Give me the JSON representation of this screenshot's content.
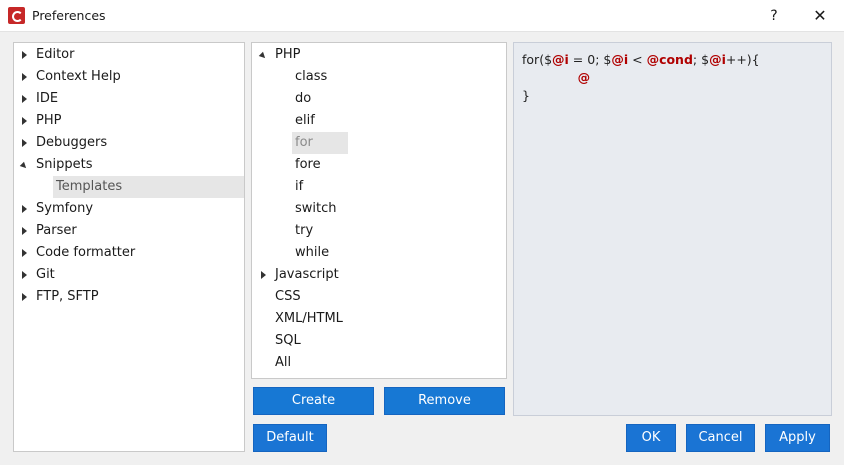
{
  "window": {
    "title": "Preferences",
    "help_label": "?",
    "close_label": "✕"
  },
  "left_tree": {
    "items": [
      {
        "label": "Editor",
        "expander": "collapsed"
      },
      {
        "label": "Context Help",
        "expander": "collapsed"
      },
      {
        "label": "IDE",
        "expander": "collapsed"
      },
      {
        "label": "PHP",
        "expander": "collapsed"
      },
      {
        "label": "Debuggers",
        "expander": "collapsed"
      },
      {
        "label": "Snippets",
        "expander": "expanded"
      },
      {
        "label": "Templates",
        "expander": "none",
        "selected": true
      },
      {
        "label": "Symfony",
        "expander": "collapsed"
      },
      {
        "label": "Parser",
        "expander": "collapsed"
      },
      {
        "label": "Code formatter",
        "expander": "collapsed"
      },
      {
        "label": "Git",
        "expander": "collapsed"
      },
      {
        "label": "FTP, SFTP",
        "expander": "collapsed"
      }
    ]
  },
  "middle_tree": {
    "items": [
      {
        "label": "PHP",
        "expander": "expanded"
      },
      {
        "label": "class",
        "expander": "none"
      },
      {
        "label": "do",
        "expander": "none"
      },
      {
        "label": "elif",
        "expander": "none"
      },
      {
        "label": "for",
        "expander": "none",
        "selected": true
      },
      {
        "label": "fore",
        "expander": "none"
      },
      {
        "label": "if",
        "expander": "none"
      },
      {
        "label": "switch",
        "expander": "none"
      },
      {
        "label": "try",
        "expander": "none"
      },
      {
        "label": "while",
        "expander": "none"
      },
      {
        "label": "Javascript",
        "expander": "collapsed"
      },
      {
        "label": "CSS",
        "expander": "none"
      },
      {
        "label": "XML/HTML",
        "expander": "none"
      },
      {
        "label": "SQL",
        "expander": "none"
      },
      {
        "label": "All",
        "expander": "none"
      }
    ]
  },
  "code": {
    "line1": [
      {
        "t": "for($",
        "v": false
      },
      {
        "t": "@i",
        "v": true
      },
      {
        "t": " = 0; $",
        "v": false
      },
      {
        "t": "@i",
        "v": true
      },
      {
        "t": " < ",
        "v": false
      },
      {
        "t": "@cond",
        "v": true
      },
      {
        "t": "; $",
        "v": false
      },
      {
        "t": "@i",
        "v": true
      },
      {
        "t": "++){",
        "v": false
      }
    ],
    "line2": [
      {
        "t": "              ",
        "v": false
      },
      {
        "t": "@",
        "v": true
      }
    ],
    "line3": [
      {
        "t": "}",
        "v": false
      }
    ]
  },
  "buttons": {
    "create": "Create",
    "remove": "Remove",
    "default": "Default",
    "ok": "OK",
    "cancel": "Cancel",
    "apply": "Apply"
  },
  "colors": {
    "accent": "#1a74d4",
    "snippet_variable": "#b00000",
    "selection": "#e6e6e6"
  }
}
